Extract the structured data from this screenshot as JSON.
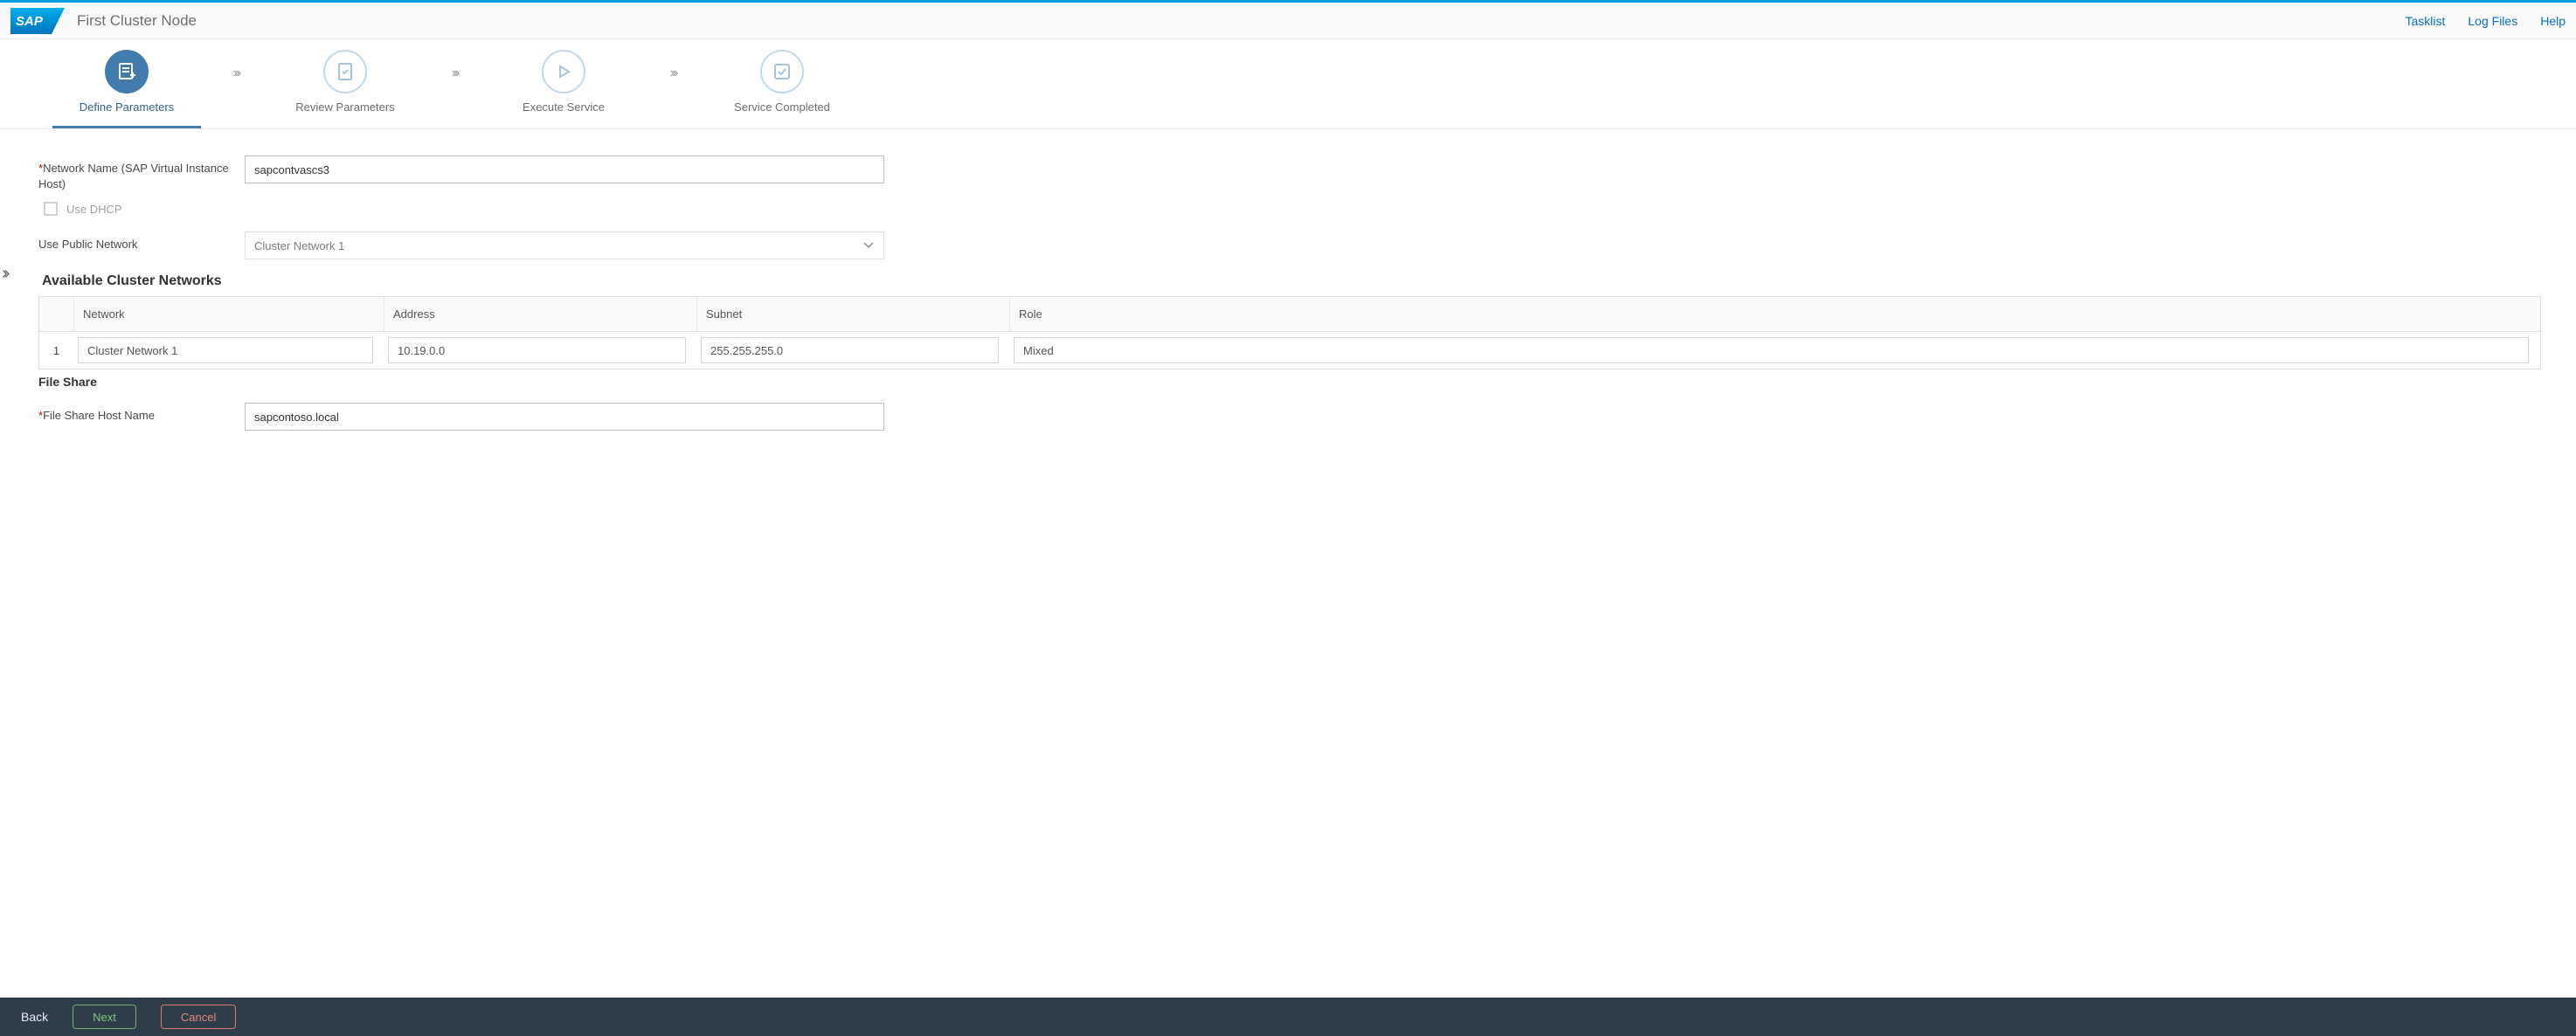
{
  "header": {
    "page_title": "First Cluster Node",
    "nav": {
      "tasklist": "Tasklist",
      "logfiles": "Log Files",
      "help": "Help"
    }
  },
  "wizard": {
    "steps": {
      "define": "Define Parameters",
      "review": "Review Parameters",
      "execute": "Execute Service",
      "completed": "Service Completed"
    }
  },
  "form": {
    "network_name_label": "Network Name (SAP Virtual Instance Host)",
    "network_name_value": "sapcontvascs3",
    "use_dhcp_label": "Use DHCP",
    "use_public_network_label": "Use Public Network",
    "use_public_network_value": "Cluster Network 1"
  },
  "sections": {
    "available_networks": "Available Cluster Networks",
    "file_share": "File Share"
  },
  "table": {
    "headers": {
      "network": "Network",
      "address": "Address",
      "subnet": "Subnet",
      "role": "Role"
    },
    "rows": [
      {
        "idx": "1",
        "network": "Cluster Network 1",
        "address": "10.19.0.0",
        "subnet": "255.255.255.0",
        "role": "Mixed"
      }
    ]
  },
  "file_share": {
    "host_label": "File Share Host Name",
    "host_value": "sapcontoso.local"
  },
  "footer": {
    "back": "Back",
    "next": "Next",
    "cancel": "Cancel"
  }
}
